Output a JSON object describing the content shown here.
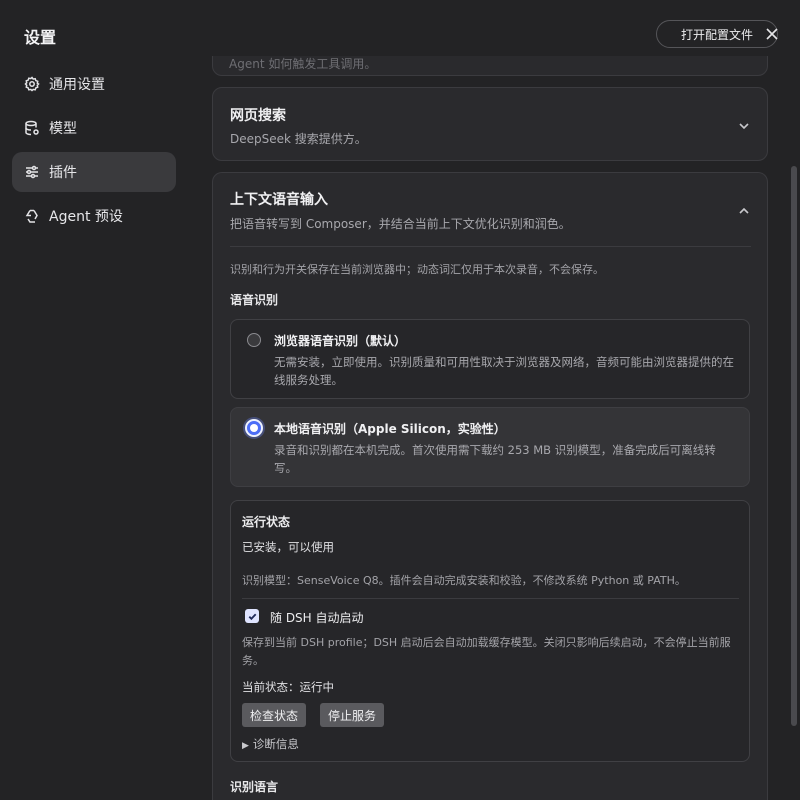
{
  "app_title": "设置",
  "header": {
    "open_config_label": "打开配置文件"
  },
  "sidebar": {
    "items": [
      {
        "label": "通用设置",
        "icon": "gear-icon",
        "active": false
      },
      {
        "label": "模型",
        "icon": "database-icon",
        "active": false
      },
      {
        "label": "插件",
        "icon": "sliders-icon",
        "active": true
      },
      {
        "label": "Agent 预设",
        "icon": "recycle-icon",
        "active": false
      }
    ]
  },
  "cards": {
    "top_partial_desc": "Agent 如何触发工具调用。",
    "web_search": {
      "title": "网页搜索",
      "desc": "DeepSeek 搜索提供方。"
    },
    "voice": {
      "title": "上下文语音输入",
      "desc": "把语音转写到 Composer，并结合当前上下文优化识别和润色。",
      "note": "识别和行为开关保存在当前浏览器中；动态词汇仅用于本次录音，不会保存。",
      "recognition_label": "语音识别",
      "options": [
        {
          "title": "浏览器语音识别（默认）",
          "desc": "无需安装，立即使用。识别质量和可用性取决于浏览器及网络，音频可能由浏览器提供的在线服务处理。",
          "selected": false
        },
        {
          "title": "本地语音识别（Apple Silicon，实验性）",
          "desc": "录音和识别都在本机完成。首次使用需下载约 253 MB 识别模型，准备完成后可离线转写。",
          "selected": true
        }
      ],
      "status": {
        "title": "运行状态",
        "state": "已安装，可以使用",
        "model_info": "识别模型：SenseVoice Q8。插件会自动完成安装和校验，不修改系统 Python 或 PATH。",
        "autostart_label": "随 DSH 自动启动",
        "autostart_checked": true,
        "autostart_desc": "保存到当前 DSH profile；DSH 启动后会自动加载缓存模型。关闭只影响后续启动，不会停止当前服务。",
        "current_state": "当前状态：运行中",
        "check_button": "检查状态",
        "stop_button": "停止服务",
        "diagnostics_label": "诊断信息"
      },
      "language_label": "识别语言"
    }
  }
}
